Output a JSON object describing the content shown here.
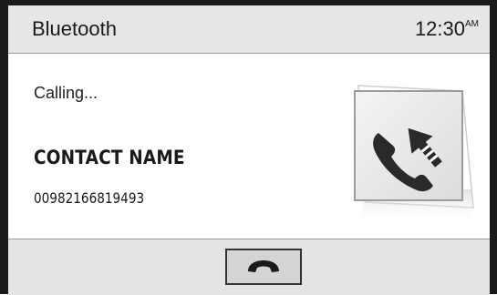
{
  "header": {
    "title": "Bluetooth",
    "time": "12:30",
    "meridiem": "AM"
  },
  "call": {
    "status": "Calling...",
    "contact_name": "CONTACT NAME",
    "number": "00982166819493",
    "illustration_icon": "outgoing-call-icon"
  },
  "footer": {
    "end_call_icon": "hang-up-icon"
  },
  "colors": {
    "header_bg": "#e6e6e6",
    "footer_bg": "#e4e4e4",
    "frame": "#1a1a1a",
    "icon_dark": "#2a2a2a"
  }
}
